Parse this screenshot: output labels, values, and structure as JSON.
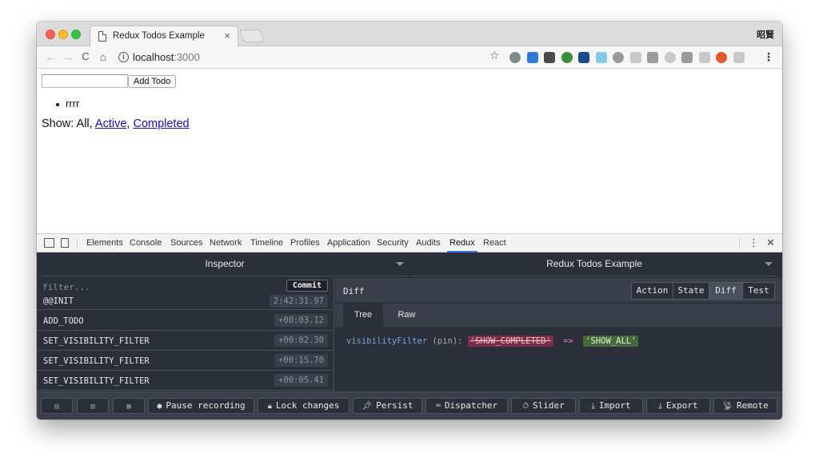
{
  "browser": {
    "tab_title": "Redux Todos Example",
    "tab_close": "×",
    "profile_label": "昭賢",
    "url_host": "localhost",
    "url_port": ":3000",
    "nav": {
      "back": "←",
      "forward": "→",
      "reload": "C",
      "home": "⌂"
    },
    "star": "☆",
    "menu": "⋮",
    "extension_colors": [
      "#7f8c8d",
      "#2a7ad6",
      "#4b4b4b",
      "#3b8f3b",
      "#1b4c8f",
      "#86c8e8",
      "#9a9a9a",
      "#c8c8c8",
      "#9a9a9a",
      "#c8c8c8",
      "#9a9a9a",
      "#c8c8c8",
      "#e05a2b",
      "#c8c8c8"
    ]
  },
  "page": {
    "add_button": "Add Todo",
    "todos": [
      "rrrr"
    ],
    "filter_prefix": "Show: All, ",
    "filter_sep": ", ",
    "filter_active": "Active",
    "filter_completed": "Completed"
  },
  "devtools": {
    "tabs": [
      "Elements",
      "Console",
      "Sources",
      "Network",
      "Timeline",
      "Profiles",
      "Application",
      "Security",
      "Audits",
      "Redux",
      "React"
    ],
    "active_tab": "Redux",
    "more": "⋮",
    "close": "✕"
  },
  "redux": {
    "monitor": "Inspector",
    "instance": "Redux Todos Example",
    "filter_placeholder": "filter...",
    "commit_label": "Commit",
    "actions": [
      {
        "name": "@@INIT",
        "time": "2:42:31.97"
      },
      {
        "name": "ADD_TODO",
        "time": "+00:03.12"
      },
      {
        "name": "SET_VISIBILITY_FILTER",
        "time": "+00:02.30"
      },
      {
        "name": "SET_VISIBILITY_FILTER",
        "time": "+00:15.70"
      },
      {
        "name": "SET_VISIBILITY_FILTER",
        "time": "+00:05.41"
      }
    ],
    "diff_title": "Diff",
    "view_tabs": [
      "Action",
      "State",
      "Diff",
      "Test"
    ],
    "active_view": "Diff",
    "sub_tabs": [
      "Tree",
      "Raw"
    ],
    "active_sub_tab": "Tree",
    "diff": {
      "key": "visibilityFilter",
      "pin": "(pin):",
      "old_value": "'SHOW_COMPLETED'",
      "arrow": "=>",
      "new_value": "'SHOW_ALL'"
    },
    "bottom_buttons": [
      {
        "label": "Pause recording",
        "glyph": "●"
      },
      {
        "label": "Lock changes",
        "glyph": "🔒︎"
      },
      {
        "label": "Persist",
        "glyph": "📌︎"
      },
      {
        "label": "Dispatcher",
        "glyph": "⌨"
      },
      {
        "label": "Slider",
        "glyph": "⏱"
      },
      {
        "label": "Import",
        "glyph": "⤓"
      },
      {
        "label": "Export",
        "glyph": "⤓"
      },
      {
        "label": "Remote",
        "glyph": "📡︎"
      }
    ],
    "layout_glyphs": [
      "▤",
      "▥",
      "▦"
    ]
  }
}
